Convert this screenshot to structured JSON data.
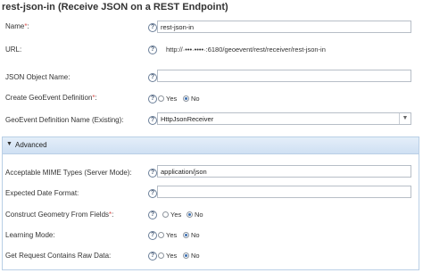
{
  "header": {
    "title": "rest-json-in (Receive JSON on a REST Endpoint)"
  },
  "fields": {
    "name": {
      "label": "Name",
      "required": "*",
      "value": "rest-json-in"
    },
    "url": {
      "label": "URL:",
      "value": "http://·•••·••••·:6180/geoevent/rest/receiver/rest-json-in"
    },
    "json_object_name": {
      "label": "JSON Object Name:",
      "value": ""
    },
    "create_geoevent_def": {
      "label": "Create GeoEvent Definition",
      "required": "*",
      "option_yes": "Yes",
      "option_no": "No",
      "selected": "No"
    },
    "geoevent_def_name": {
      "label": "GeoEvent Definition Name (Existing):",
      "value": "HttpJsonReceiver"
    }
  },
  "advanced": {
    "header": "Advanced",
    "mime_types": {
      "label": "Acceptable MIME Types (Server Mode):",
      "value": "application/json"
    },
    "date_format": {
      "label": "Expected Date Format:",
      "value": ""
    },
    "construct_geometry": {
      "label": "Construct Geometry From Fields",
      "required": "*",
      "option_yes": "Yes",
      "option_no": "No",
      "selected": "No"
    },
    "learning_mode": {
      "label": "Learning Mode:",
      "option_yes": "Yes",
      "option_no": "No",
      "selected": "No"
    },
    "raw_data": {
      "label": "Get Request Contains Raw Data:",
      "option_yes": "Yes",
      "option_no": "No",
      "selected": "No"
    }
  },
  "icons": {
    "help": "help-icon",
    "expand": "caret-down-icon",
    "dropdown": "chevron-down-icon"
  },
  "colors": {
    "required": "#d9534f",
    "advanced_header": "#d9e7f6",
    "radio_selected": "#3c6fb0"
  }
}
